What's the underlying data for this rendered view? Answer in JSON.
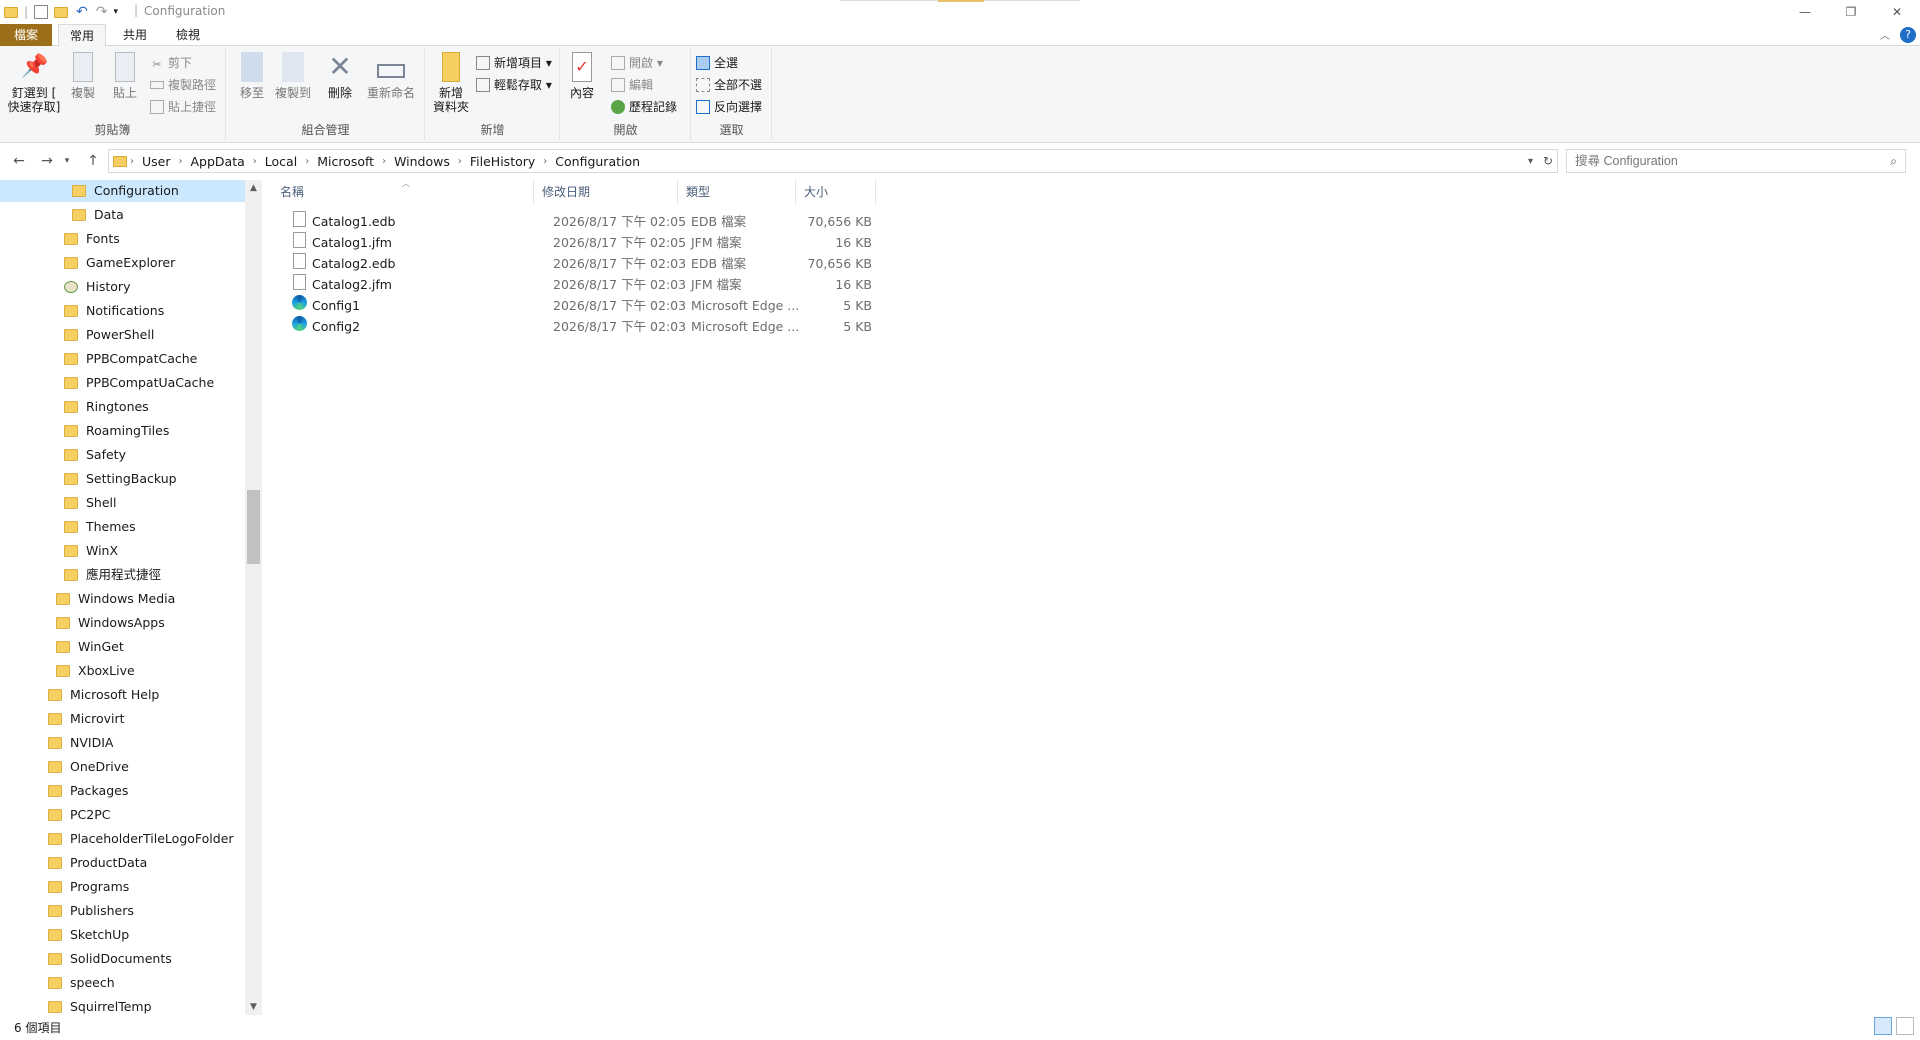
{
  "window": {
    "title": "Configuration",
    "minimize": "—",
    "maximize": "❐",
    "close": "✕"
  },
  "tabs": [
    {
      "label": "檔案"
    },
    {
      "label": "常用"
    },
    {
      "label": "共用"
    },
    {
      "label": "檢視"
    }
  ],
  "ribbon": {
    "clipboard": {
      "pin_label_1": "釘選到 [",
      "pin_label_2": "快速存取]",
      "copy": "複製",
      "paste": "貼上",
      "cut": "剪下",
      "copy_path": "複製路徑",
      "paste_shortcut": "貼上捷徑",
      "group": "剪貼簿"
    },
    "organize": {
      "move_to": "移至",
      "copy_to": "複製到",
      "delete": "刪除",
      "rename": "重新命名",
      "group": "組合管理"
    },
    "new": {
      "new_folder_1": "新增",
      "new_folder_2": "資料夾",
      "new_item": "新增項目 ▾",
      "easy_access": "輕鬆存取 ▾",
      "group": "新增"
    },
    "open": {
      "properties": "內容",
      "open": "開啟 ▾",
      "edit": "編輯",
      "history": "歷程記錄",
      "group": "開啟"
    },
    "select": {
      "select_all": "全選",
      "select_none": "全部不選",
      "invert": "反向選擇",
      "group": "選取"
    }
  },
  "address": {
    "crumbs": [
      "User",
      "AppData",
      "Local",
      "Microsoft",
      "Windows",
      "FileHistory",
      "Configuration"
    ],
    "search_placeholder": "搜尋 Configuration"
  },
  "nav": {
    "items": [
      {
        "label": "Configuration",
        "indent": 3,
        "selected": true
      },
      {
        "label": "Data",
        "indent": 3
      },
      {
        "label": "Fonts",
        "indent": 2
      },
      {
        "label": "GameExplorer",
        "indent": 2
      },
      {
        "label": "History",
        "indent": 2,
        "icon": "history"
      },
      {
        "label": "Notifications",
        "indent": 2
      },
      {
        "label": "PowerShell",
        "indent": 2
      },
      {
        "label": "PPBCompatCache",
        "indent": 2
      },
      {
        "label": "PPBCompatUaCache",
        "indent": 2
      },
      {
        "label": "Ringtones",
        "indent": 2
      },
      {
        "label": "RoamingTiles",
        "indent": 2
      },
      {
        "label": "Safety",
        "indent": 2
      },
      {
        "label": "SettingBackup",
        "indent": 2
      },
      {
        "label": "Shell",
        "indent": 2
      },
      {
        "label": "Themes",
        "indent": 2
      },
      {
        "label": "WinX",
        "indent": 2
      },
      {
        "label": "應用程式捷徑",
        "indent": 2
      },
      {
        "label": "Windows Media",
        "indent": 1
      },
      {
        "label": "WindowsApps",
        "indent": 1
      },
      {
        "label": "WinGet",
        "indent": 1
      },
      {
        "label": "XboxLive",
        "indent": 1
      },
      {
        "label": "Microsoft Help",
        "indent": 0
      },
      {
        "label": "Microvirt",
        "indent": 0
      },
      {
        "label": "NVIDIA",
        "indent": 0
      },
      {
        "label": "OneDrive",
        "indent": 0
      },
      {
        "label": "Packages",
        "indent": 0
      },
      {
        "label": "PC2PC",
        "indent": 0
      },
      {
        "label": "PlaceholderTileLogoFolder",
        "indent": 0
      },
      {
        "label": "ProductData",
        "indent": 0
      },
      {
        "label": "Programs",
        "indent": 0
      },
      {
        "label": "Publishers",
        "indent": 0
      },
      {
        "label": "SketchUp",
        "indent": 0
      },
      {
        "label": "SolidDocuments",
        "indent": 0
      },
      {
        "label": "speech",
        "indent": 0
      },
      {
        "label": "SquirrelTemp",
        "indent": 0
      }
    ]
  },
  "columns": {
    "name": "名稱",
    "date": "修改日期",
    "type": "類型",
    "size": "大小"
  },
  "files": [
    {
      "name": "Catalog1.edb",
      "date": "2026/8/17 下午 02:05",
      "type": "EDB 檔案",
      "size": "70,656 KB",
      "icon": "doc"
    },
    {
      "name": "Catalog1.jfm",
      "date": "2026/8/17 下午 02:05",
      "type": "JFM 檔案",
      "size": "16 KB",
      "icon": "doc"
    },
    {
      "name": "Catalog2.edb",
      "date": "2026/8/17 下午 02:03",
      "type": "EDB 檔案",
      "size": "70,656 KB",
      "icon": "doc"
    },
    {
      "name": "Catalog2.jfm",
      "date": "2026/8/17 下午 02:03",
      "type": "JFM 檔案",
      "size": "16 KB",
      "icon": "doc"
    },
    {
      "name": "Config1",
      "date": "2026/8/17 下午 02:03",
      "type": "Microsoft Edge ...",
      "size": "5 KB",
      "icon": "edge"
    },
    {
      "name": "Config2",
      "date": "2026/8/17 下午 02:03",
      "type": "Microsoft Edge ...",
      "size": "5 KB",
      "icon": "edge"
    }
  ],
  "status": {
    "count": "6 個項目"
  }
}
